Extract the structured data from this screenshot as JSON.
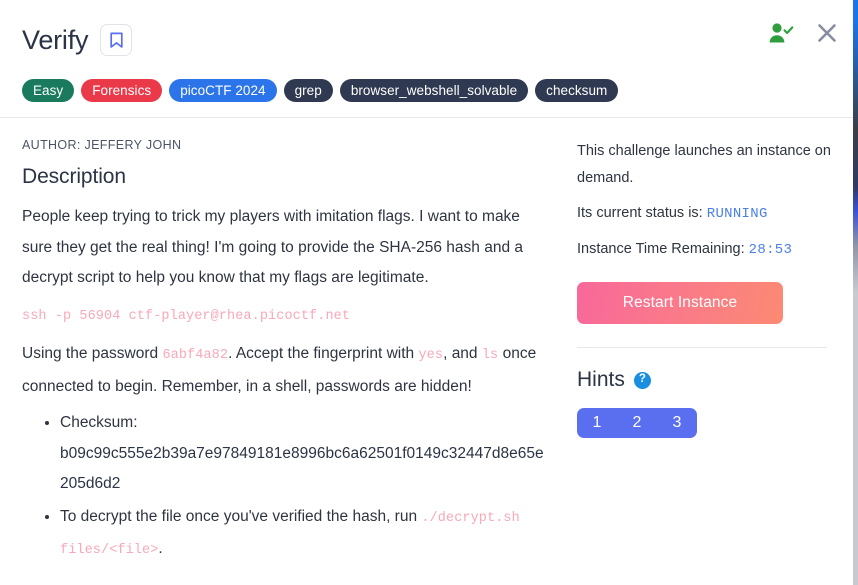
{
  "header": {
    "title": "Verify",
    "bookmark_icon": "bookmark-icon",
    "solved_icon": "user-check-icon",
    "close_icon": "close-icon"
  },
  "tags": [
    {
      "label": "Easy",
      "color": "#1a7a5e"
    },
    {
      "label": "Forensics",
      "color": "#ea3a4a"
    },
    {
      "label": "picoCTF 2024",
      "color": "#2b74ea"
    },
    {
      "label": "grep",
      "color": "#2f3951"
    },
    {
      "label": "browser_webshell_solvable",
      "color": "#2f3951"
    },
    {
      "label": "checksum",
      "color": "#2f3951"
    }
  ],
  "content": {
    "author": "AUTHOR: JEFFERY JOHN",
    "description_heading": "Description",
    "paragraph_1": "People keep trying to trick my players with imitation flags. I want to make sure they get the real thing! I'm going to provide the SHA-256 hash and a decrypt script to help you know that my flags are legitimate.",
    "ssh_command": "ssh -p 56904 ctf-player@rhea.picoctf.net",
    "password_line": {
      "prefix": "Using the password ",
      "password": "6abf4a82",
      "middle": ". Accept the fingerprint with ",
      "yes": "yes",
      "and": ", and ",
      "ls": "ls",
      "suffix": " once connected to begin. Remember, in a shell, passwords are hidden!"
    },
    "bullets": [
      {
        "label": "Checksum:",
        "value": "b09c99c555e2b39a7e97849181e8996bc6a62501f0149c32447d8e65e205d6d2"
      },
      {
        "prefix": "To decrypt the file once you've verified the hash, run ",
        "code": "./decrypt.sh files/<file>",
        "suffix": "."
      }
    ]
  },
  "sidebar": {
    "instance_notice": "This challenge launches an instance on demand.",
    "status_label": "Its current status is: ",
    "status_value": "RUNNING",
    "time_label": "Instance Time Remaining: ",
    "time_value": "28:53",
    "restart_label": "Restart Instance",
    "hints_title": "Hints",
    "hints_help_icon": "question-mark-icon",
    "hint_buttons": [
      "1",
      "2",
      "3"
    ]
  },
  "colors": {
    "accent_blue": "#5a6ff0",
    "status_blue": "#4a7fe8",
    "code_pink": "#f8a8b8",
    "restart_gradient_start": "#f8689a",
    "restart_gradient_end": "#fb8a73",
    "solved_green": "#2e9e3f"
  }
}
